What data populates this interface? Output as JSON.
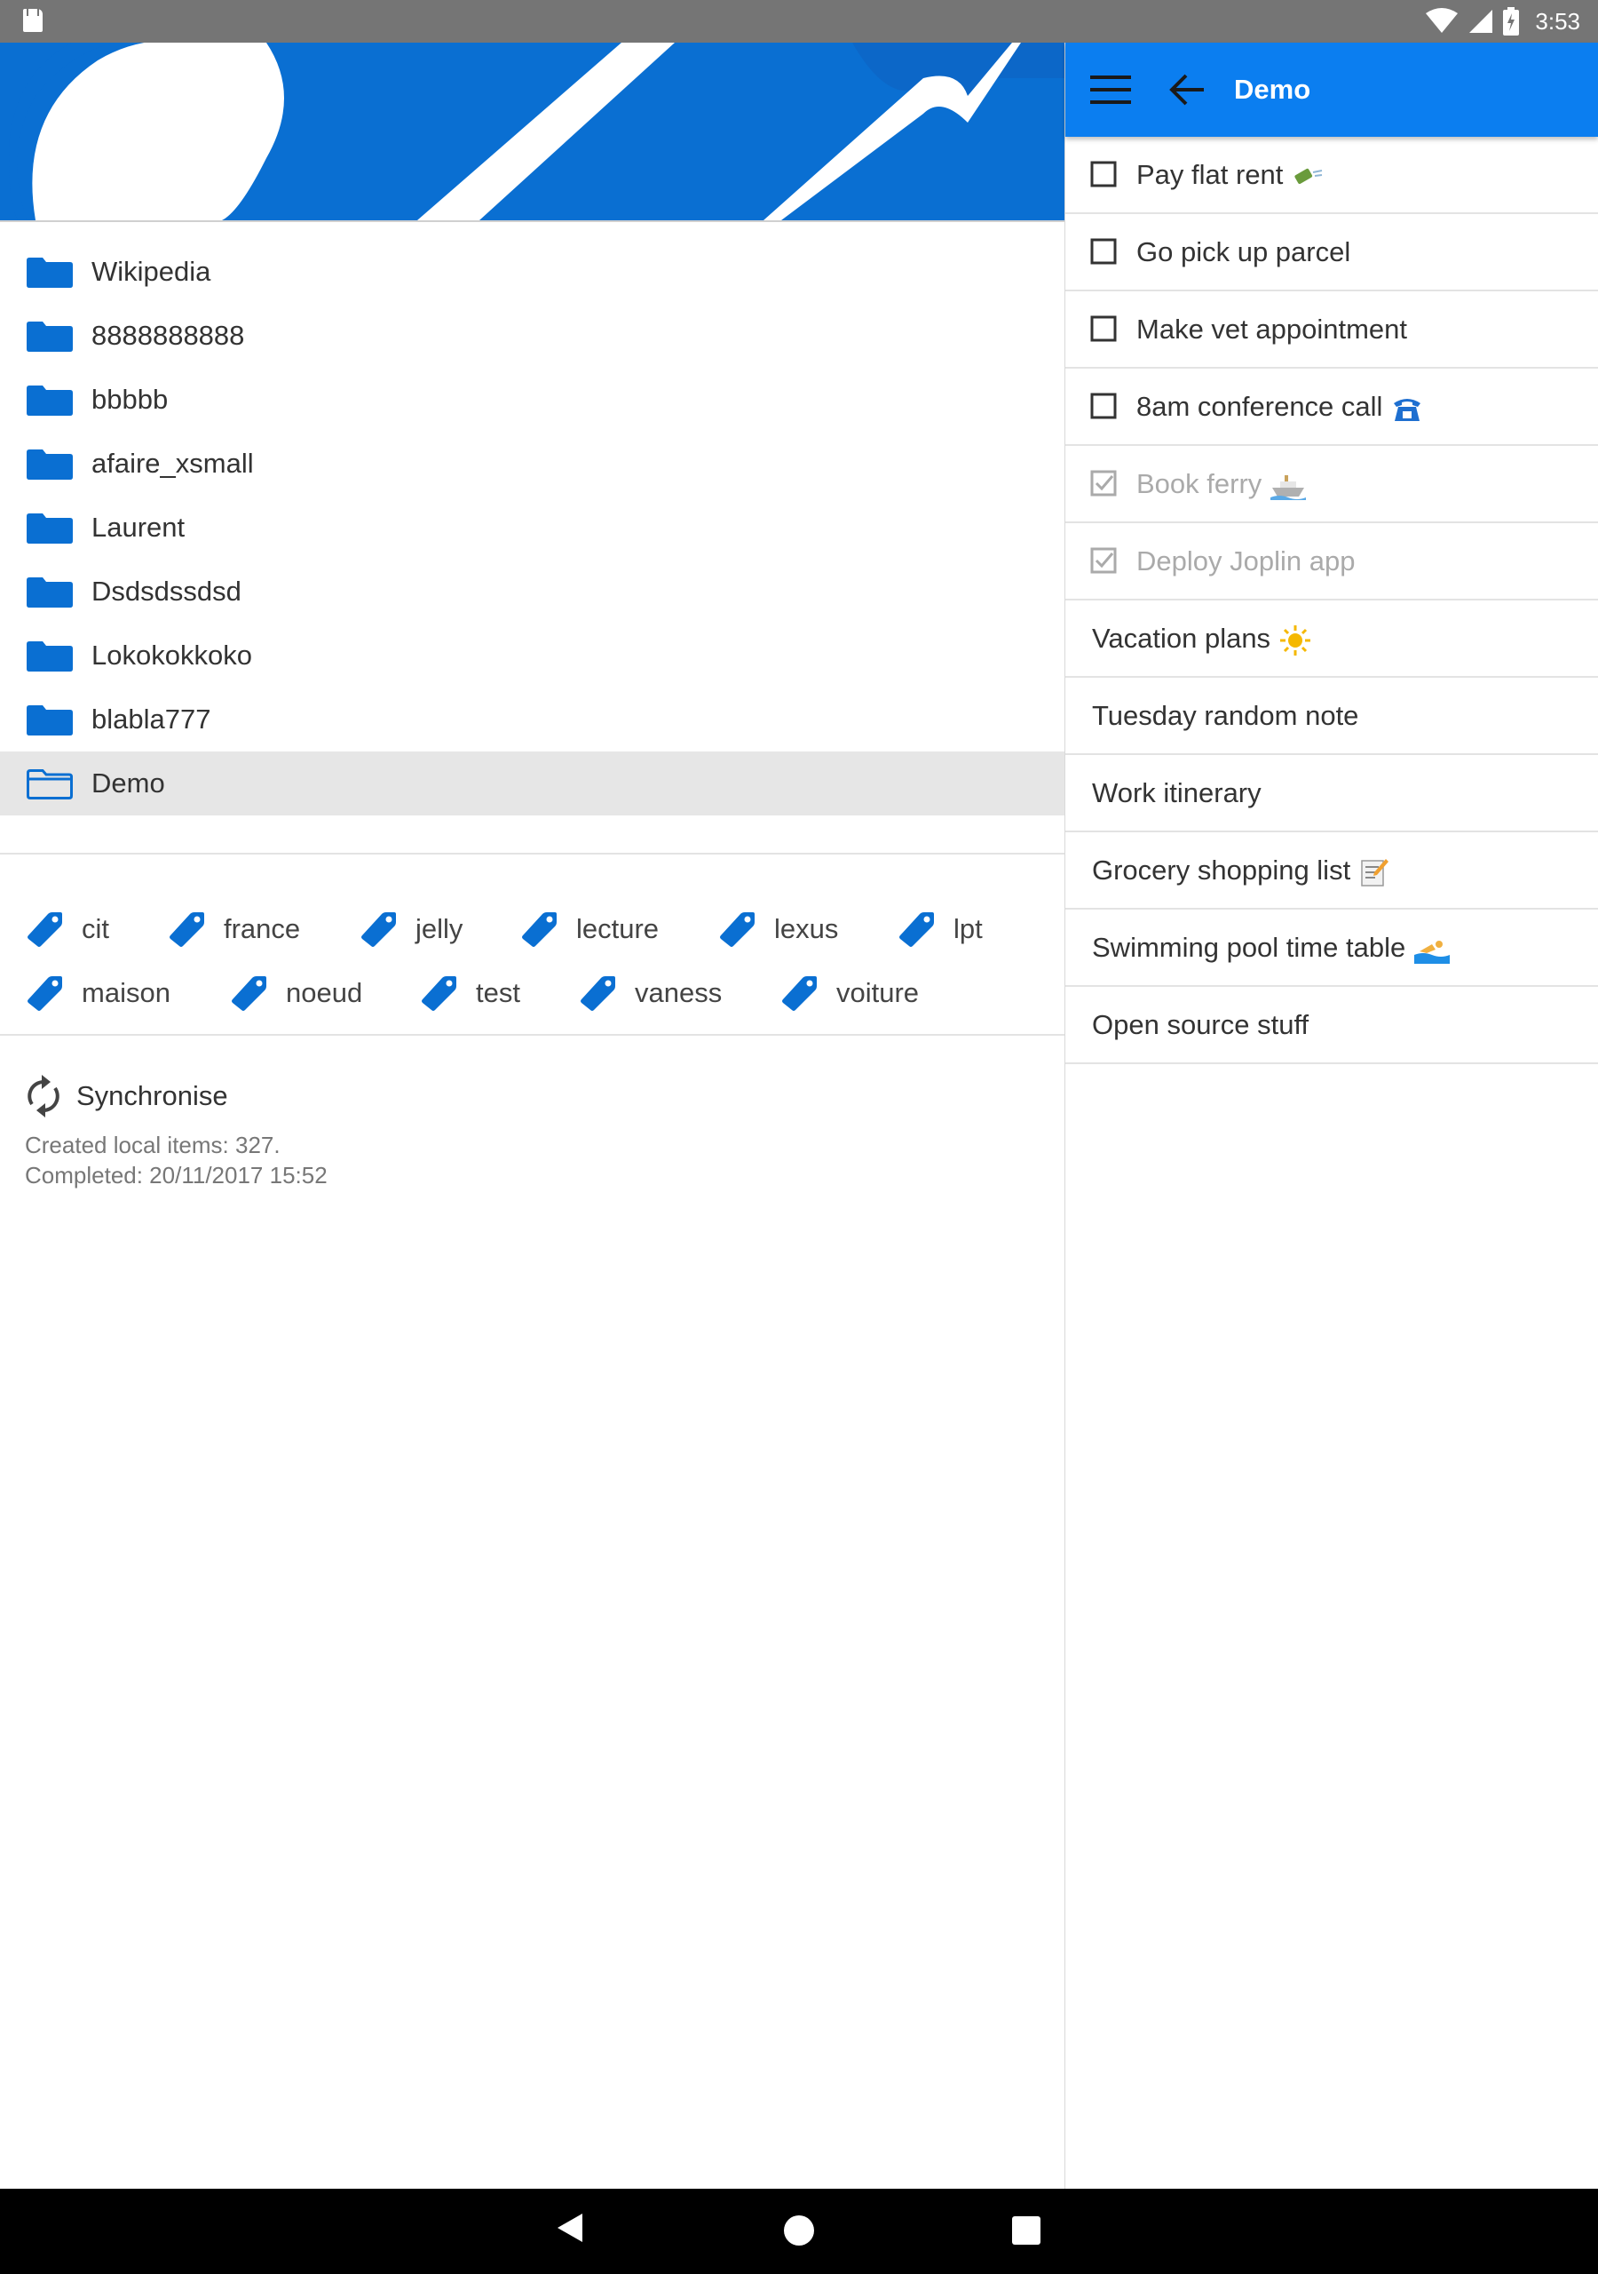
{
  "status_bar": {
    "time": "3:53"
  },
  "drawer": {
    "folders": [
      {
        "label": "Wikipedia"
      },
      {
        "label": "8888888888"
      },
      {
        "label": "bbbbb"
      },
      {
        "label": "afaire_xsmall"
      },
      {
        "label": "Laurent"
      },
      {
        "label": "Dsdsdssdsd"
      },
      {
        "label": "Lokokokkoko"
      },
      {
        "label": "blabla777"
      },
      {
        "label": "Demo",
        "selected": true
      }
    ],
    "tags": [
      {
        "label": "cit"
      },
      {
        "label": "france"
      },
      {
        "label": "jelly"
      },
      {
        "label": "lecture"
      },
      {
        "label": "lexus"
      },
      {
        "label": "lpt"
      },
      {
        "label": "maison"
      },
      {
        "label": "noeud"
      },
      {
        "label": "test"
      },
      {
        "label": "vaness"
      },
      {
        "label": "voiture"
      }
    ],
    "sync": {
      "label": "Synchronise",
      "created_items": "Created local items: 327.",
      "completed": "Completed: 20/11/2017 15:52"
    }
  },
  "header": {
    "title": "Demo"
  },
  "notes": [
    {
      "label": "Pay flat rent",
      "type": "todo",
      "done": false,
      "emoji": "money-icon"
    },
    {
      "label": "Go pick up parcel",
      "type": "todo",
      "done": false
    },
    {
      "label": "Make vet appointment",
      "type": "todo",
      "done": false
    },
    {
      "label": "8am conference call",
      "type": "todo",
      "done": false,
      "emoji": "telephone-icon"
    },
    {
      "label": "Book ferry",
      "type": "todo",
      "done": true,
      "emoji": "ship-icon"
    },
    {
      "label": "Deploy Joplin app",
      "type": "todo",
      "done": true
    },
    {
      "label": "Vacation plans",
      "type": "note",
      "emoji": "sun-icon"
    },
    {
      "label": "Tuesday random note",
      "type": "note"
    },
    {
      "label": "Work itinerary",
      "type": "note"
    },
    {
      "label": "Grocery shopping list",
      "type": "note",
      "emoji": "memo-icon"
    },
    {
      "label": "Swimming pool time table",
      "type": "note",
      "emoji": "swimmer-icon"
    },
    {
      "label": "Open source stuff",
      "type": "note"
    }
  ],
  "colors": {
    "accent": "#0b7ef0",
    "folder_blue": "#0a6fd2",
    "status_bar": "#757575",
    "selected_row": "#e6e6e6",
    "done_text": "#aaaaaa"
  }
}
